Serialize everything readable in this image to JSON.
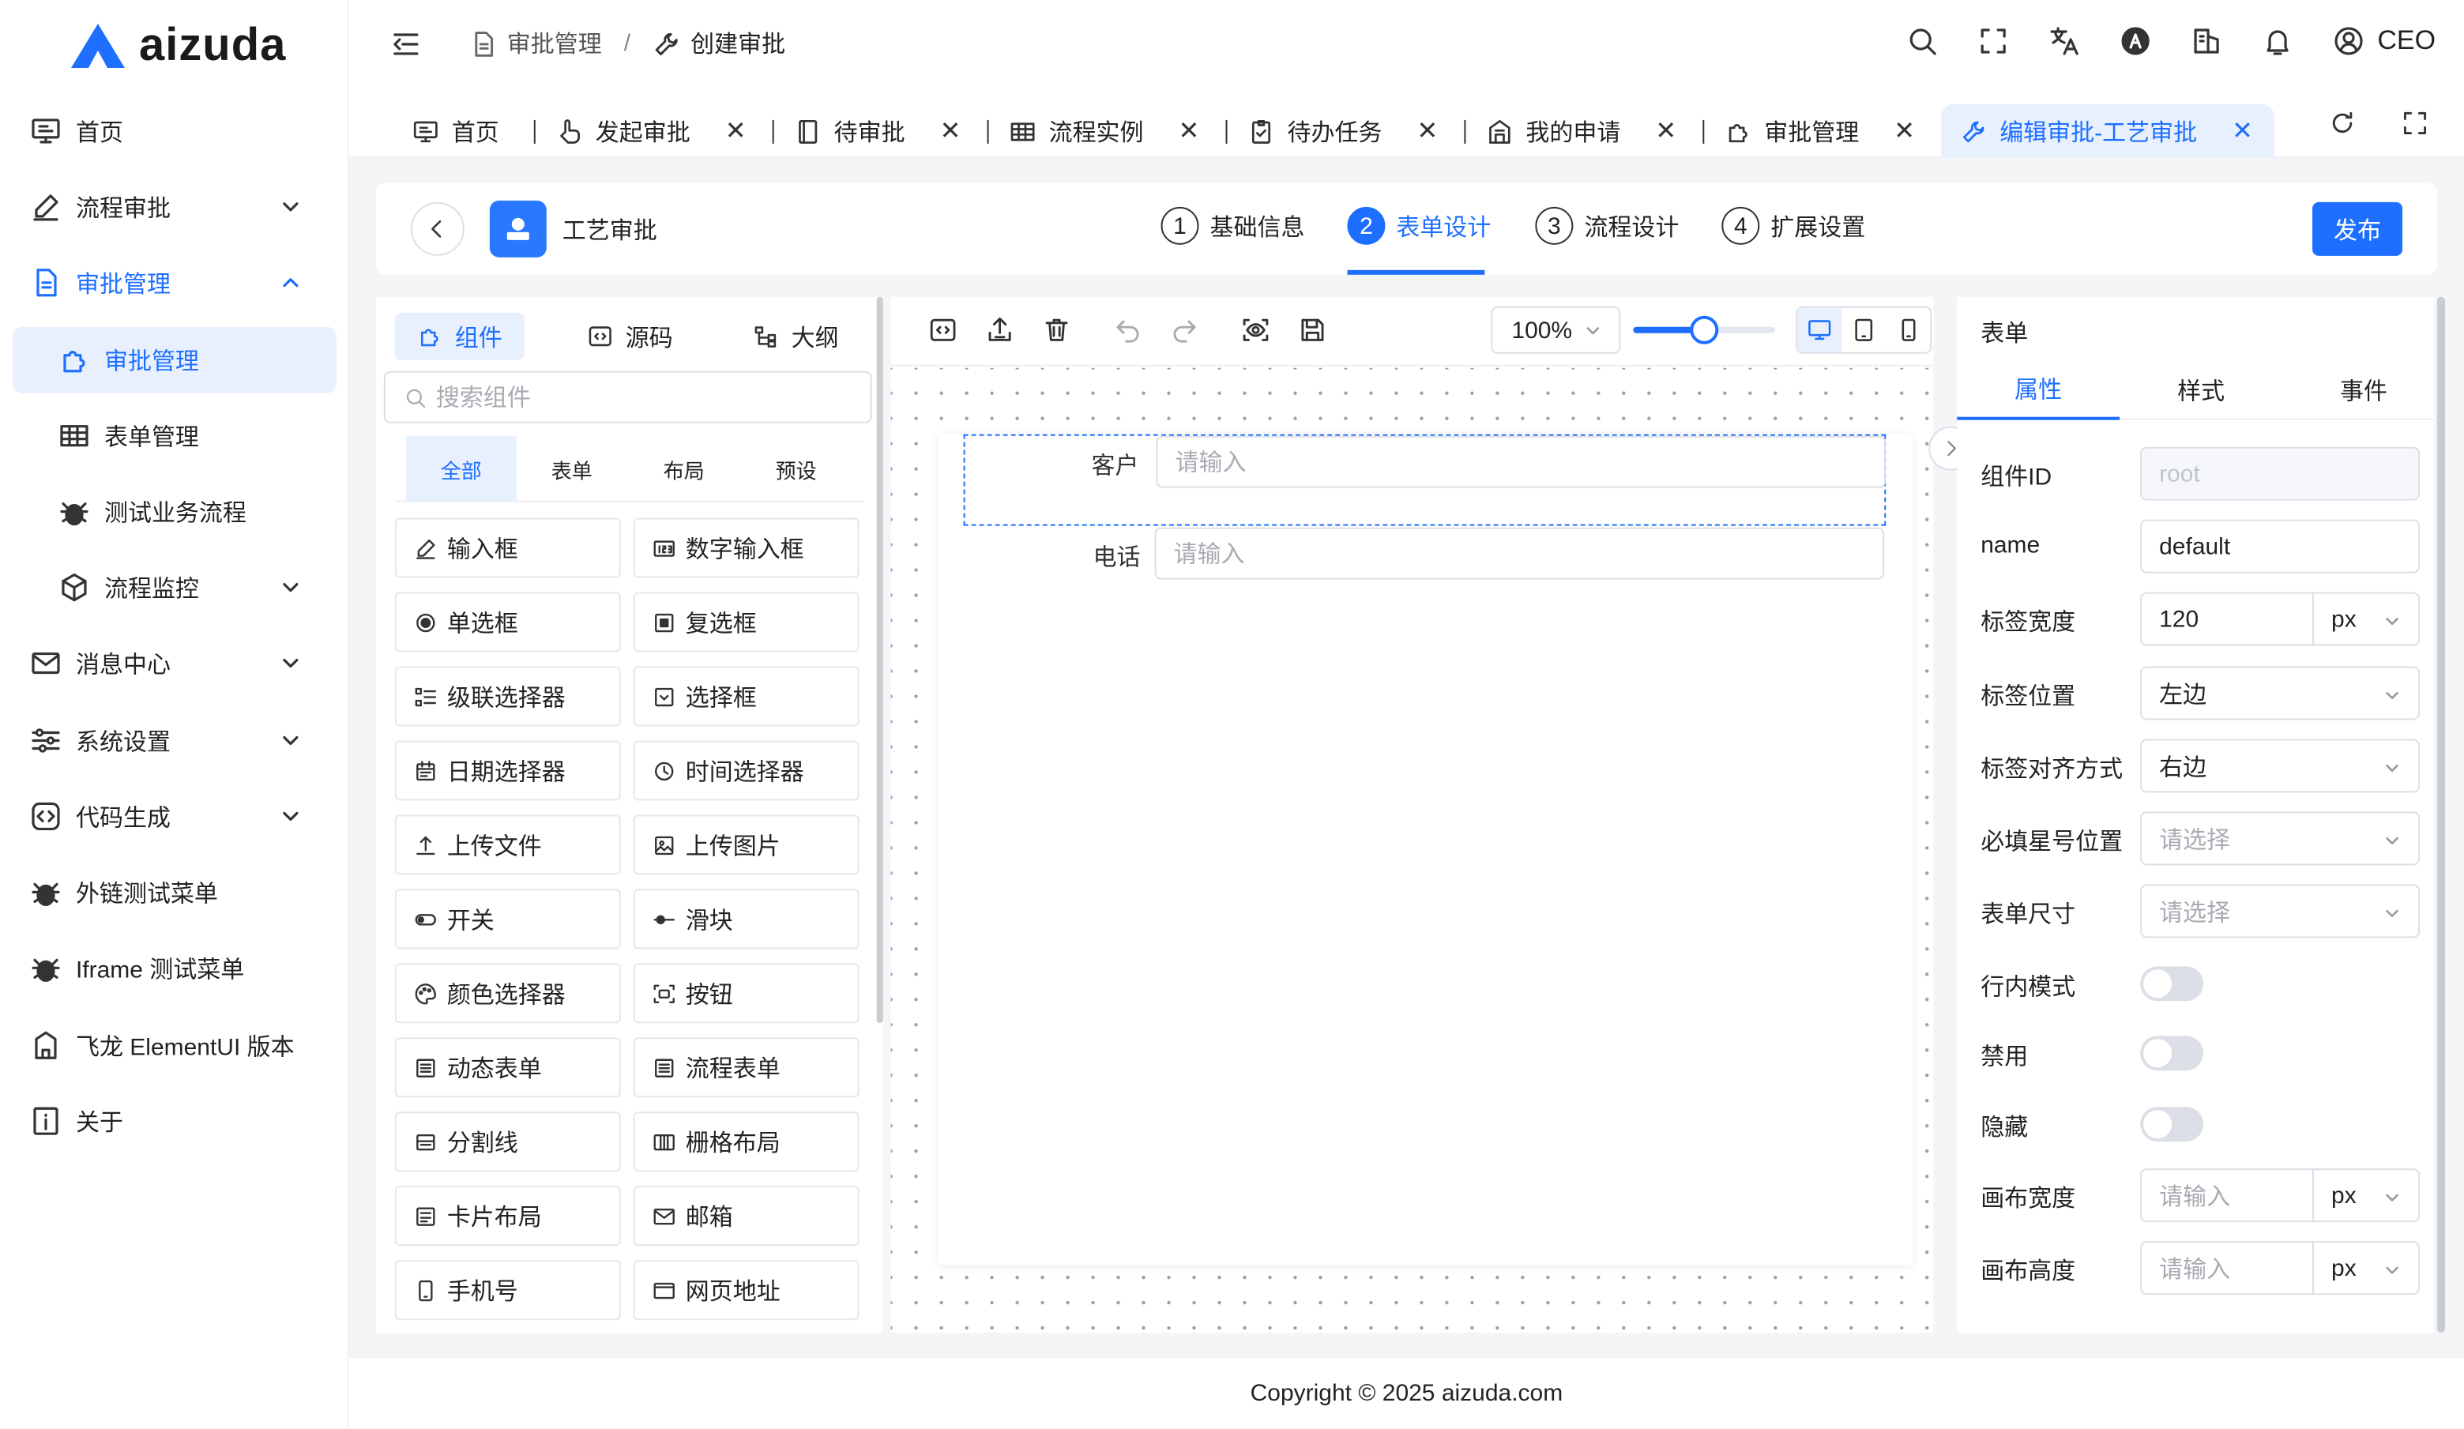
{
  "brand": {
    "name": "aizuda",
    "accent": "#1e6fff"
  },
  "sidebar": {
    "items": [
      {
        "label": "首页",
        "icon": "monitor-icon"
      },
      {
        "label": "流程审批",
        "icon": "pen-icon"
      },
      {
        "label": "审批管理",
        "icon": "document-icon"
      },
      {
        "label": "审批管理",
        "icon": "puzzle-icon"
      },
      {
        "label": "表单管理",
        "icon": "table-icon"
      },
      {
        "label": "测试业务流程",
        "icon": "bug-icon"
      },
      {
        "label": "流程监控",
        "icon": "cube-icon"
      },
      {
        "label": "消息中心",
        "icon": "mail-icon"
      },
      {
        "label": "系统设置",
        "icon": "sliders-icon"
      },
      {
        "label": "代码生成",
        "icon": "code-icon"
      },
      {
        "label": "外链测试菜单",
        "icon": "bug-icon"
      },
      {
        "label": "Iframe 测试菜单",
        "icon": "bug-icon"
      },
      {
        "label": "飞龙 ElementUI 版本",
        "icon": "home-icon"
      },
      {
        "label": "关于",
        "icon": "info-icon"
      }
    ]
  },
  "header": {
    "breadcrumb": [
      "审批管理",
      "/",
      "创建审批"
    ],
    "user": "CEO"
  },
  "tabs": [
    {
      "label": "首页"
    },
    {
      "label": "发起审批"
    },
    {
      "label": "待审批"
    },
    {
      "label": "流程实例"
    },
    {
      "label": "待办任务"
    },
    {
      "label": "我的申请"
    },
    {
      "label": "审批管理"
    },
    {
      "label": "编辑审批-工艺审批"
    }
  ],
  "steps_bar": {
    "app_name": "工艺审批",
    "steps": [
      {
        "num": "1",
        "label": "基础信息"
      },
      {
        "num": "2",
        "label": "表单设计"
      },
      {
        "num": "3",
        "label": "流程设计"
      },
      {
        "num": "4",
        "label": "扩展设置"
      }
    ],
    "publish": "发布"
  },
  "components_panel": {
    "tabs": [
      "组件",
      "源码",
      "大纲"
    ],
    "search_placeholder": "搜索组件",
    "categories": [
      "全部",
      "表单",
      "布局",
      "预设"
    ],
    "items": [
      "输入框",
      "数字输入框",
      "单选框",
      "复选框",
      "级联选择器",
      "选择框",
      "日期选择器",
      "时间选择器",
      "上传文件",
      "上传图片",
      "开关",
      "滑块",
      "颜色选择器",
      "按钮",
      "动态表单",
      "流程表单",
      "分割线",
      "栅格布局",
      "卡片布局",
      "邮箱",
      "手机号",
      "网页地址"
    ]
  },
  "canvas": {
    "zoom": "100%",
    "zoom_slider_fraction": 0.5,
    "fields": [
      {
        "label": "客户",
        "placeholder": "请输入"
      },
      {
        "label": "电话",
        "placeholder": "请输入"
      }
    ]
  },
  "properties": {
    "title": "表单",
    "tabs": [
      "属性",
      "样式",
      "事件"
    ],
    "rows": {
      "component_id": {
        "label": "组件ID",
        "value": "root"
      },
      "name": {
        "label": "name",
        "value": "default"
      },
      "label_width": {
        "label": "标签宽度",
        "value": "120",
        "unit": "px"
      },
      "label_position": {
        "label": "标签位置",
        "value": "左边"
      },
      "label_align": {
        "label": "标签对齐方式",
        "value": "右边"
      },
      "required_star": {
        "label": "必填星号位置",
        "placeholder": "请选择"
      },
      "form_size": {
        "label": "表单尺寸",
        "placeholder": "请选择"
      },
      "inline": {
        "label": "行内模式"
      },
      "disabled": {
        "label": "禁用"
      },
      "hidden": {
        "label": "隐藏"
      },
      "canvas_width": {
        "label": "画布宽度",
        "placeholder": "请输入",
        "unit": "px"
      },
      "canvas_height": {
        "label": "画布高度",
        "placeholder": "请输入",
        "unit": "px"
      }
    }
  },
  "footer": {
    "text": "Copyright © 2025 aizuda.com"
  }
}
